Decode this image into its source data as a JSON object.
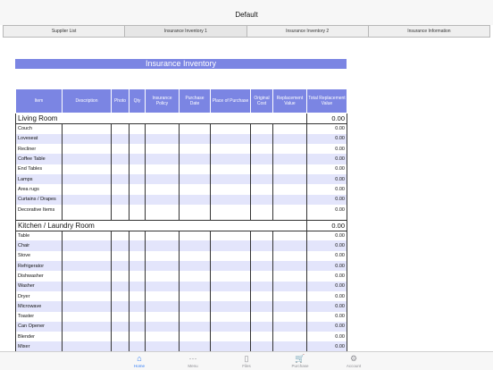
{
  "window": {
    "title": "Default"
  },
  "tabs": [
    "Supplier List",
    "Insurance Inventory 1",
    "Insurance Inventory 2",
    "Insurance Information"
  ],
  "sheet": {
    "title": "Insurance Inventory",
    "headers": [
      "Item",
      "Description",
      "Photo",
      "Qty",
      "Insurance Policy",
      "Purchase Date",
      "Place of Purchase",
      "Original Cost",
      "Replacement Value",
      "Total Replacement Value"
    ],
    "sections": [
      {
        "name": "Living Room",
        "total": "0.00",
        "items": [
          {
            "name": "Couch",
            "value": "0.00"
          },
          {
            "name": "Loveseat",
            "value": "0.00"
          },
          {
            "name": "Recliner",
            "value": "0.00"
          },
          {
            "name": "Coffee Table",
            "value": "0.00"
          },
          {
            "name": "End Tables",
            "value": "0.00"
          },
          {
            "name": "Lamps",
            "value": "0.00"
          },
          {
            "name": "Area rugs",
            "value": "0.00"
          },
          {
            "name": "Curtains / Drapes",
            "value": "0.00"
          },
          {
            "name": "Decorative Items",
            "value": "0.00"
          }
        ]
      },
      {
        "name": "Kitchen / Laundry Room",
        "total": "0.00",
        "items": [
          {
            "name": "Table",
            "value": "0.00"
          },
          {
            "name": "Chair",
            "value": "0.00"
          },
          {
            "name": "Stove",
            "value": "0.00"
          },
          {
            "name": "Refrigerator",
            "value": "0.00"
          },
          {
            "name": "Dishwasher",
            "value": "0.00"
          },
          {
            "name": "Washer",
            "value": "0.00"
          },
          {
            "name": "Dryer",
            "value": "0.00"
          },
          {
            "name": "Microwave",
            "value": "0.00"
          },
          {
            "name": "Toaster",
            "value": "0.00"
          },
          {
            "name": "Can Opener",
            "value": "0.00"
          },
          {
            "name": "Blender",
            "value": "0.00"
          },
          {
            "name": "Mixer",
            "value": "0.00"
          }
        ]
      }
    ]
  },
  "tabbar": [
    {
      "label": "Home",
      "icon": "home-icon",
      "glyph": "⌂",
      "active": true
    },
    {
      "label": "Menu",
      "icon": "more-icon",
      "glyph": "⋯",
      "active": false
    },
    {
      "label": "Files",
      "icon": "file-icon",
      "glyph": "▯",
      "active": false
    },
    {
      "label": "Purchase",
      "icon": "cart-icon",
      "glyph": "🛒",
      "active": false
    },
    {
      "label": "Account",
      "icon": "gear-icon",
      "glyph": "⚙",
      "active": false
    }
  ],
  "colors": {
    "accent": "#7b85e3",
    "stripe": "#e3e5fb",
    "tab_active": "#2f7cf6"
  }
}
